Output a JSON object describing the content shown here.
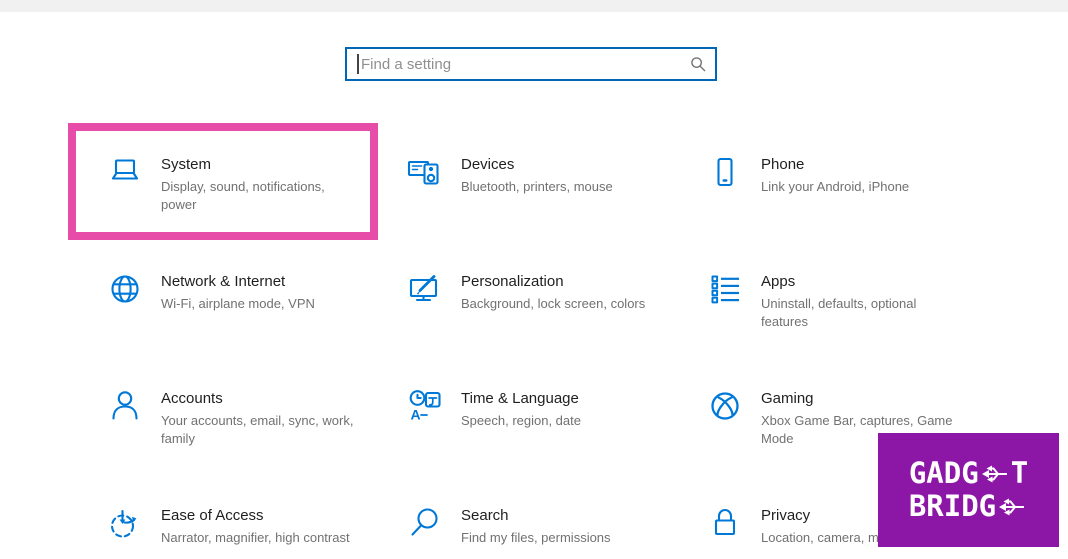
{
  "colors": {
    "accent_blue": "#0078d7",
    "search_border": "#0067b8",
    "highlight_pink": "#e64ca8",
    "watermark_purple": "#8c17a7",
    "topbar_gray": "#f1f1f1"
  },
  "search": {
    "placeholder": "Find a setting",
    "icon": "search-icon"
  },
  "highlight": {
    "target": "System"
  },
  "tiles": [
    {
      "title": "System",
      "subtitle": "Display, sound, notifications, power",
      "icon": "laptop-icon",
      "highlighted": true
    },
    {
      "title": "Devices",
      "subtitle": "Bluetooth, printers, mouse",
      "icon": "keyboard-speaker-icon"
    },
    {
      "title": "Phone",
      "subtitle": "Link your Android, iPhone",
      "icon": "phone-icon"
    },
    {
      "title": "Network & Internet",
      "subtitle": "Wi-Fi, airplane mode, VPN",
      "icon": "globe-icon"
    },
    {
      "title": "Personalization",
      "subtitle": "Background, lock screen, colors",
      "icon": "monitor-brush-icon"
    },
    {
      "title": "Apps",
      "subtitle": "Uninstall, defaults, optional features",
      "icon": "apps-list-icon"
    },
    {
      "title": "Accounts",
      "subtitle": "Your accounts, email, sync, work, family",
      "icon": "person-icon"
    },
    {
      "title": "Time & Language",
      "subtitle": "Speech, region, date",
      "icon": "clock-language-icon"
    },
    {
      "title": "Gaming",
      "subtitle": "Xbox Game Bar, captures, Game Mode",
      "icon": "xbox-icon"
    },
    {
      "title": "Ease of Access",
      "subtitle": "Narrator, magnifier, high contrast",
      "icon": "ease-of-access-icon"
    },
    {
      "title": "Search",
      "subtitle": "Find my files, permissions",
      "icon": "magnifier-icon"
    },
    {
      "title": "Privacy",
      "subtitle": "Location, camera, m",
      "icon": "lock-icon"
    }
  ],
  "watermark": {
    "line1_left": "GADG",
    "line1_right": "T",
    "line2_left": "BRIDG",
    "line2_right": "",
    "icon": "usb-icon"
  }
}
